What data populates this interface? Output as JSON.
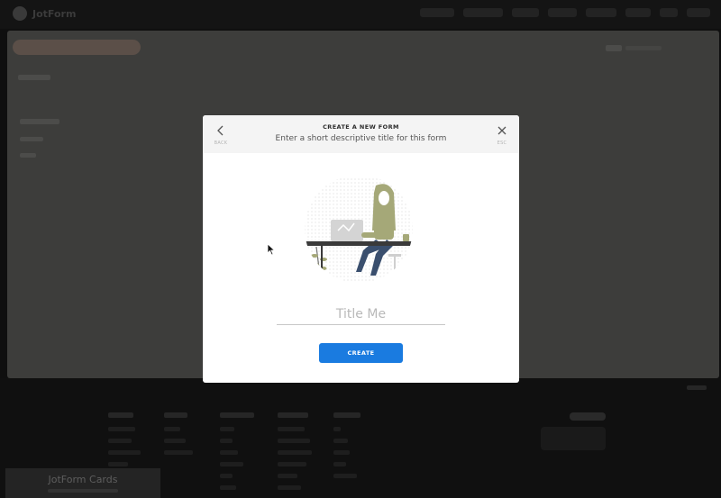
{
  "app": {
    "logo_text": "JotForm"
  },
  "modal": {
    "back_label": "BACK",
    "close_label": "ESC",
    "title": "CREATE A NEW FORM",
    "subtitle": "Enter a short descriptive title for this form",
    "input_placeholder": "Title Me",
    "input_value": "",
    "create_label": "CREATE"
  },
  "cards_tab": {
    "title": "JotForm Cards"
  },
  "colors": {
    "accent": "#1a7be0",
    "illustration_olive": "#a5a878",
    "illustration_blue": "#3a4f6e"
  },
  "icons": {
    "back": "chevron-left-icon",
    "close": "close-icon",
    "logo": "jotform-logo-icon",
    "cursor": "mouse-pointer-icon"
  }
}
